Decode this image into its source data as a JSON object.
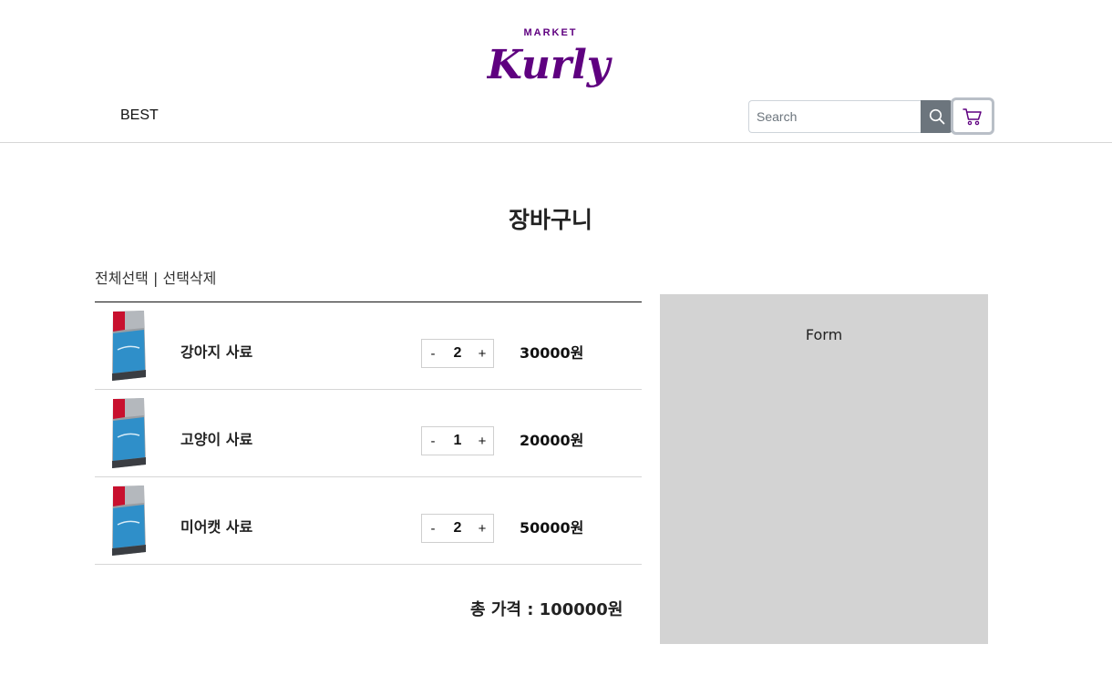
{
  "header": {
    "logo_text": "MARKET Kurly",
    "nav": {
      "best_label": "BEST"
    },
    "search": {
      "placeholder": "Search",
      "button_icon": "search-icon"
    },
    "cart_icon": "cart-icon",
    "brand_color": "#5f0080"
  },
  "page": {
    "title": "장바구니"
  },
  "selection": {
    "select_all": "전체선택",
    "separator": "|",
    "delete_selected": "선택삭제"
  },
  "cart": {
    "items": [
      {
        "name": "강아지 사료",
        "quantity_minus": "-",
        "quantity": "2",
        "quantity_plus": "+",
        "price": "30000원"
      },
      {
        "name": "고양이 사료",
        "quantity_minus": "-",
        "quantity": "1",
        "quantity_plus": "+",
        "price": "20000원"
      },
      {
        "name": "미어캣 사료",
        "quantity_minus": "-",
        "quantity": "2",
        "quantity_plus": "+",
        "price": "50000원"
      }
    ],
    "total_label": "총 가격 : 100000원"
  },
  "form_panel": {
    "label": "Form"
  }
}
